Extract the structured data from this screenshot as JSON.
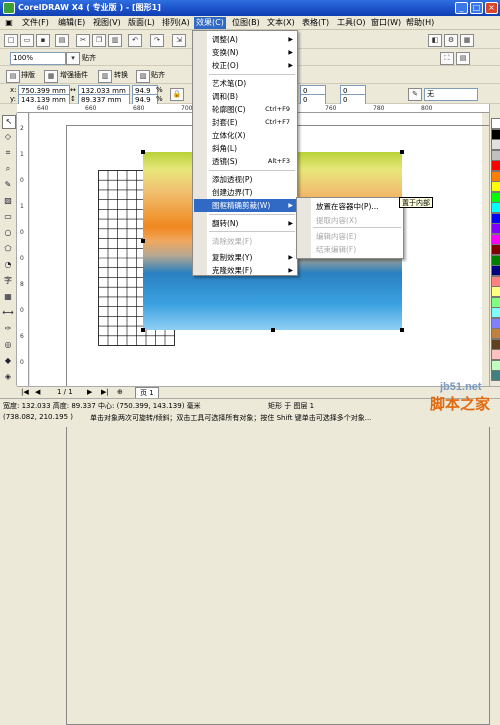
{
  "window": {
    "title": "CorelDRAW X4 ( 专业版 ) - [图形1]",
    "controls": [
      "_",
      "□",
      "×"
    ]
  },
  "menubar": {
    "items": [
      "文件(F)",
      "编辑(E)",
      "视图(V)",
      "版面(L)",
      "排列(A)",
      "效果(C)",
      "位图(B)",
      "文本(X)",
      "表格(T)",
      "工具(O)",
      "窗口(W)",
      "帮助(H)"
    ]
  },
  "toolbar": {
    "zoom": "100%",
    "snap_label": "贴齐",
    "docker_tabs": [
      "排版",
      "增强插件",
      "转换",
      "贴齐"
    ]
  },
  "propbar": {
    "x": "750.399 mm",
    "y": "143.139 mm",
    "w": "132.033 mm",
    "h": "89.337 mm",
    "sx": "94.9",
    "sy": "94.9",
    "pct": "%",
    "rot": "0",
    "outline": "无"
  },
  "ruler": {
    "top_nums": [
      "640",
      "660",
      "680",
      "700",
      "720",
      "740",
      "760",
      "780",
      "800"
    ],
    "left_nums": [
      "2",
      "1",
      "0",
      "1",
      "0",
      "0",
      "8",
      "0",
      "6",
      "0"
    ]
  },
  "effects_menu": {
    "items": [
      {
        "label": "调整(A)",
        "arrow": "▶"
      },
      {
        "label": "变换(N)",
        "arrow": "▶"
      },
      {
        "label": "校正(O)",
        "arrow": "▶"
      },
      {
        "label": "艺术笔(D)"
      },
      {
        "label": "调和(B)"
      },
      {
        "label": "轮廓图(C)",
        "shortcut": "Ctrl+F9"
      },
      {
        "label": "封套(E)",
        "shortcut": "Ctrl+F7"
      },
      {
        "label": "立体化(X)"
      },
      {
        "label": "斜角(L)"
      },
      {
        "label": "透镜(S)",
        "shortcut": "Alt+F3"
      },
      {
        "label": "添加透视(P)"
      },
      {
        "label": "创建边界(T)"
      },
      {
        "label": "图框精确剪裁(W)",
        "arrow": "▶"
      },
      {
        "label": "翻转(N)",
        "arrow": "▶"
      },
      {
        "label": "清除效果(F)"
      },
      {
        "label": "复制效果(Y)",
        "arrow": "▶"
      },
      {
        "label": "克隆效果(F)",
        "arrow": "▶"
      }
    ]
  },
  "powerclip_menu": {
    "items": [
      {
        "label": "放置在容器中(P)..."
      },
      {
        "label": "提取内容(X)"
      },
      {
        "label": "编辑内容(E)"
      },
      {
        "label": "结束编辑(F)"
      }
    ]
  },
  "tooltip": "置于内部",
  "pagebar": {
    "page_count": "1 / 1",
    "page_tab": "页 1"
  },
  "status": {
    "line1": "宽度: 132.033  高度: 89.337  中心: (750.399, 143.139)  毫米",
    "layer": "矩形 于 图层 1",
    "coords": "(738.082, 210.195 )",
    "hint": "单击对象两次可旋转/倾斜；双击工具可选择所有对象；按住 Shift 键单击可选择多个对象..."
  },
  "watermark": {
    "line1": "jb51.net",
    "line2": "脚本之家"
  },
  "colors": {
    "palette": [
      "#ffffff",
      "#000000",
      "#e0e0e0",
      "#c0c0c0",
      "#ff0000",
      "#ff8000",
      "#ffff00",
      "#00ff00",
      "#00ffff",
      "#0000ff",
      "#8000ff",
      "#ff00ff",
      "#800000",
      "#008000",
      "#000080",
      "#ff8080",
      "#ffff80",
      "#80ff80",
      "#80ffff",
      "#8080ff",
      "#c08040",
      "#604020",
      "#ffc0c0",
      "#c0ffc0",
      "#408080"
    ],
    "highlight": "#316ac5"
  }
}
